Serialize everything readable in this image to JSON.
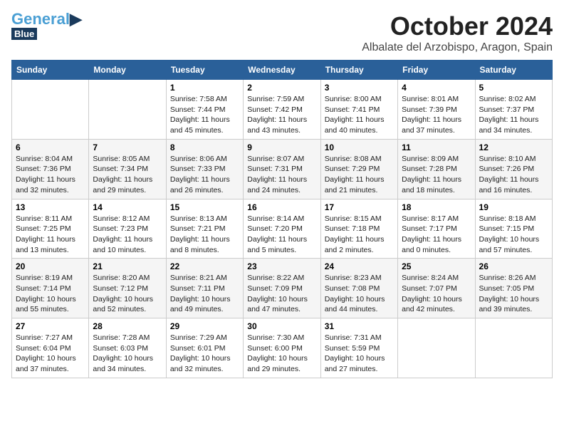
{
  "header": {
    "logo_general": "General",
    "logo_blue": "Blue",
    "month_title": "October 2024",
    "location": "Albalate del Arzobispo, Aragon, Spain"
  },
  "weekdays": [
    "Sunday",
    "Monday",
    "Tuesday",
    "Wednesday",
    "Thursday",
    "Friday",
    "Saturday"
  ],
  "weeks": [
    [
      {
        "day": "",
        "sunrise": "",
        "sunset": "",
        "daylight": ""
      },
      {
        "day": "",
        "sunrise": "",
        "sunset": "",
        "daylight": ""
      },
      {
        "day": "1",
        "sunrise": "Sunrise: 7:58 AM",
        "sunset": "Sunset: 7:44 PM",
        "daylight": "Daylight: 11 hours and 45 minutes."
      },
      {
        "day": "2",
        "sunrise": "Sunrise: 7:59 AM",
        "sunset": "Sunset: 7:42 PM",
        "daylight": "Daylight: 11 hours and 43 minutes."
      },
      {
        "day": "3",
        "sunrise": "Sunrise: 8:00 AM",
        "sunset": "Sunset: 7:41 PM",
        "daylight": "Daylight: 11 hours and 40 minutes."
      },
      {
        "day": "4",
        "sunrise": "Sunrise: 8:01 AM",
        "sunset": "Sunset: 7:39 PM",
        "daylight": "Daylight: 11 hours and 37 minutes."
      },
      {
        "day": "5",
        "sunrise": "Sunrise: 8:02 AM",
        "sunset": "Sunset: 7:37 PM",
        "daylight": "Daylight: 11 hours and 34 minutes."
      }
    ],
    [
      {
        "day": "6",
        "sunrise": "Sunrise: 8:04 AM",
        "sunset": "Sunset: 7:36 PM",
        "daylight": "Daylight: 11 hours and 32 minutes."
      },
      {
        "day": "7",
        "sunrise": "Sunrise: 8:05 AM",
        "sunset": "Sunset: 7:34 PM",
        "daylight": "Daylight: 11 hours and 29 minutes."
      },
      {
        "day": "8",
        "sunrise": "Sunrise: 8:06 AM",
        "sunset": "Sunset: 7:33 PM",
        "daylight": "Daylight: 11 hours and 26 minutes."
      },
      {
        "day": "9",
        "sunrise": "Sunrise: 8:07 AM",
        "sunset": "Sunset: 7:31 PM",
        "daylight": "Daylight: 11 hours and 24 minutes."
      },
      {
        "day": "10",
        "sunrise": "Sunrise: 8:08 AM",
        "sunset": "Sunset: 7:29 PM",
        "daylight": "Daylight: 11 hours and 21 minutes."
      },
      {
        "day": "11",
        "sunrise": "Sunrise: 8:09 AM",
        "sunset": "Sunset: 7:28 PM",
        "daylight": "Daylight: 11 hours and 18 minutes."
      },
      {
        "day": "12",
        "sunrise": "Sunrise: 8:10 AM",
        "sunset": "Sunset: 7:26 PM",
        "daylight": "Daylight: 11 hours and 16 minutes."
      }
    ],
    [
      {
        "day": "13",
        "sunrise": "Sunrise: 8:11 AM",
        "sunset": "Sunset: 7:25 PM",
        "daylight": "Daylight: 11 hours and 13 minutes."
      },
      {
        "day": "14",
        "sunrise": "Sunrise: 8:12 AM",
        "sunset": "Sunset: 7:23 PM",
        "daylight": "Daylight: 11 hours and 10 minutes."
      },
      {
        "day": "15",
        "sunrise": "Sunrise: 8:13 AM",
        "sunset": "Sunset: 7:21 PM",
        "daylight": "Daylight: 11 hours and 8 minutes."
      },
      {
        "day": "16",
        "sunrise": "Sunrise: 8:14 AM",
        "sunset": "Sunset: 7:20 PM",
        "daylight": "Daylight: 11 hours and 5 minutes."
      },
      {
        "day": "17",
        "sunrise": "Sunrise: 8:15 AM",
        "sunset": "Sunset: 7:18 PM",
        "daylight": "Daylight: 11 hours and 2 minutes."
      },
      {
        "day": "18",
        "sunrise": "Sunrise: 8:17 AM",
        "sunset": "Sunset: 7:17 PM",
        "daylight": "Daylight: 11 hours and 0 minutes."
      },
      {
        "day": "19",
        "sunrise": "Sunrise: 8:18 AM",
        "sunset": "Sunset: 7:15 PM",
        "daylight": "Daylight: 10 hours and 57 minutes."
      }
    ],
    [
      {
        "day": "20",
        "sunrise": "Sunrise: 8:19 AM",
        "sunset": "Sunset: 7:14 PM",
        "daylight": "Daylight: 10 hours and 55 minutes."
      },
      {
        "day": "21",
        "sunrise": "Sunrise: 8:20 AM",
        "sunset": "Sunset: 7:12 PM",
        "daylight": "Daylight: 10 hours and 52 minutes."
      },
      {
        "day": "22",
        "sunrise": "Sunrise: 8:21 AM",
        "sunset": "Sunset: 7:11 PM",
        "daylight": "Daylight: 10 hours and 49 minutes."
      },
      {
        "day": "23",
        "sunrise": "Sunrise: 8:22 AM",
        "sunset": "Sunset: 7:09 PM",
        "daylight": "Daylight: 10 hours and 47 minutes."
      },
      {
        "day": "24",
        "sunrise": "Sunrise: 8:23 AM",
        "sunset": "Sunset: 7:08 PM",
        "daylight": "Daylight: 10 hours and 44 minutes."
      },
      {
        "day": "25",
        "sunrise": "Sunrise: 8:24 AM",
        "sunset": "Sunset: 7:07 PM",
        "daylight": "Daylight: 10 hours and 42 minutes."
      },
      {
        "day": "26",
        "sunrise": "Sunrise: 8:26 AM",
        "sunset": "Sunset: 7:05 PM",
        "daylight": "Daylight: 10 hours and 39 minutes."
      }
    ],
    [
      {
        "day": "27",
        "sunrise": "Sunrise: 7:27 AM",
        "sunset": "Sunset: 6:04 PM",
        "daylight": "Daylight: 10 hours and 37 minutes."
      },
      {
        "day": "28",
        "sunrise": "Sunrise: 7:28 AM",
        "sunset": "Sunset: 6:03 PM",
        "daylight": "Daylight: 10 hours and 34 minutes."
      },
      {
        "day": "29",
        "sunrise": "Sunrise: 7:29 AM",
        "sunset": "Sunset: 6:01 PM",
        "daylight": "Daylight: 10 hours and 32 minutes."
      },
      {
        "day": "30",
        "sunrise": "Sunrise: 7:30 AM",
        "sunset": "Sunset: 6:00 PM",
        "daylight": "Daylight: 10 hours and 29 minutes."
      },
      {
        "day": "31",
        "sunrise": "Sunrise: 7:31 AM",
        "sunset": "Sunset: 5:59 PM",
        "daylight": "Daylight: 10 hours and 27 minutes."
      },
      {
        "day": "",
        "sunrise": "",
        "sunset": "",
        "daylight": ""
      },
      {
        "day": "",
        "sunrise": "",
        "sunset": "",
        "daylight": ""
      }
    ]
  ]
}
